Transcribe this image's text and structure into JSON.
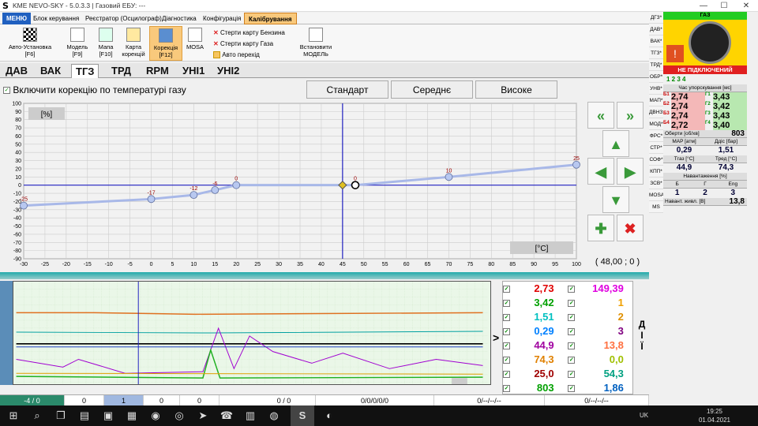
{
  "window": {
    "title": "KME NEVO-SKY - 5.0.3.3 | Газовий ЕБУ: ---",
    "min": "—",
    "max": "☐",
    "close": "✕"
  },
  "menu": {
    "items": [
      "МЕНЮ",
      "Блок керування",
      "Реєстратор (Осцилограф)",
      "Діагностика",
      "Конфігурація",
      "Калібрування"
    ]
  },
  "ribbon": {
    "auto": {
      "l1": "Авто-Установка",
      "l2": "[F6]"
    },
    "model": {
      "l1": "Модель",
      "l2": "[F9]"
    },
    "map": {
      "l1": "Мапа",
      "l2": "[F10]"
    },
    "corrmap": {
      "l1": "Карта",
      "l2": "корекцій"
    },
    "corr": {
      "l1": "Корекція",
      "l2": "[F12]"
    },
    "mosa": {
      "l1": "MOSA",
      "l2": ""
    },
    "erase_petrol": "Стерти карту Бензина",
    "erase_gas": "Стерти карту Газа",
    "auto_switch": "Авто перехід",
    "set_model": {
      "l1": "Встановити",
      "l2": "МОДЕЛЬ"
    }
  },
  "tabs": [
    "ДАВ",
    "ВАК",
    "ТГЗ",
    "ТРД",
    "RPM",
    "УНІ1",
    "УНІ2"
  ],
  "correction": {
    "label": "Включити корекцію по температурі газу",
    "presets": [
      "Стандарт",
      "Середнє",
      "Високе"
    ]
  },
  "chart_data": {
    "type": "line",
    "xlabel": "[°C]",
    "ylabel": "[%]",
    "xlim": [
      -30,
      100
    ],
    "ylim": [
      -90,
      100
    ],
    "x_ticks": [
      -30,
      -25,
      -20,
      -15,
      -10,
      -5,
      0,
      5,
      10,
      15,
      20,
      25,
      30,
      35,
      40,
      45,
      50,
      55,
      60,
      65,
      70,
      75,
      80,
      85,
      90,
      95,
      100
    ],
    "y_ticks": [
      100,
      90,
      80,
      70,
      60,
      50,
      40,
      30,
      20,
      10,
      0,
      -10,
      -20,
      -30,
      -40,
      -50,
      -60,
      -70,
      -80,
      -90
    ],
    "series": [
      {
        "x": [
          -30,
          0,
          10,
          15,
          20,
          48,
          70,
          100
        ],
        "y": [
          -25,
          -17,
          -12,
          -6,
          0,
          0,
          10,
          25
        ],
        "labels": [
          "-25",
          "-17",
          "-12",
          "-6",
          "0",
          "0",
          "10",
          "25"
        ]
      }
    ],
    "cursor_x": 45,
    "cursor_y": 0,
    "grid": true
  },
  "coord": "( 48,00 ; 0 )",
  "scope": {
    "y_label": ">"
  },
  "values": [
    {
      "a": "2,73",
      "ac": "#e00000",
      "b": "149,39",
      "bc": "#e000e0"
    },
    {
      "a": "3,42",
      "ac": "#00a000",
      "b": "1",
      "bc": "#f0a000"
    },
    {
      "a": "1,51",
      "ac": "#00c0c0",
      "b": "2",
      "bc": "#e09000"
    },
    {
      "a": "0,29",
      "ac": "#0080ff",
      "b": "3",
      "bc": "#800080"
    },
    {
      "a": "44,9",
      "ac": "#a000a0",
      "b": "13,8",
      "bc": "#ff7040"
    },
    {
      "a": "74,3",
      "ac": "#e08000",
      "b": "0,0",
      "bc": "#a0c000"
    },
    {
      "a": "25,0",
      "ac": "#a00000",
      "b": "54,3",
      "bc": "#00a080"
    },
    {
      "a": "803",
      "ac": "#00a000",
      "b": "1,86",
      "bc": "#0060c0"
    }
  ],
  "actions": [
    "Д",
    "І",
    "Ї"
  ],
  "status": [
    "-4 / 0",
    "0",
    "1",
    "0",
    "0",
    "0 / 0",
    "0/0/0/0/0",
    "0/--/--/--",
    "0/--/--/--"
  ],
  "side_items": [
    "ДГЗ*",
    "ДАВ*",
    "ВАК*",
    "ТГЗ*",
    "ТРД*",
    "ОБР*",
    "УНВ*",
    "МАП*",
    "ДВНЗ*",
    "МОД*",
    "ФРС*",
    "СТР*",
    "СОФ*",
    "КПП*",
    "ЗСВ*",
    "MOSA*",
    "MS"
  ],
  "right": {
    "gas": "ГАЗ",
    "status": "НЕ ПІДКЛЮЧЕНИЙ",
    "inj": "1 2 3 4",
    "inj_head": "Час упорскування [мс]",
    "b": [
      [
        "Б1",
        "2,74"
      ],
      [
        "Б2",
        "2,74"
      ],
      [
        "Б3",
        "2,74"
      ],
      [
        "Б4",
        "2,72"
      ]
    ],
    "g": [
      [
        "Г1",
        "3,43"
      ],
      [
        "Г2",
        "3,42"
      ],
      [
        "Г3",
        "3,43"
      ],
      [
        "Г4",
        "3,40"
      ]
    ],
    "rpm_l": "Оберти [об/хв]",
    "rpm": "803",
    "map_l": "MAP [атм]",
    "map": "0,29",
    "pd_l": "Ддіс [бар]",
    "pd": "1,51",
    "tg_l": "Тгаз [°C]",
    "tg": "44,9",
    "tr_l": "Тред [°C]",
    "tr": "74,3",
    "load_l": "Навантаження [%]",
    "bl": "Б",
    "gl": "Г",
    "el": "Eng",
    "bv": "1",
    "gv": "2",
    "ev": "3",
    "sup_l": "Навант. живл. [В]",
    "sup": "13,8"
  },
  "taskbar": {
    "time": "19:25",
    "date": "01.04.2021",
    "lang": "UK"
  }
}
